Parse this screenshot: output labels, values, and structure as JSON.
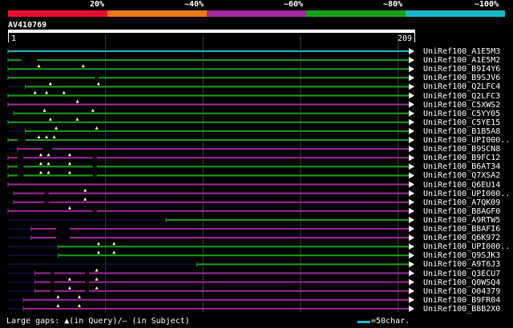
{
  "legend": {
    "labels": [
      "20%",
      "~40%",
      "~60%",
      "~80%",
      "~100%"
    ],
    "colors": [
      "#e8102e",
      "#e87818",
      "#a0289e",
      "#18a018",
      "#18b8c8"
    ]
  },
  "query": {
    "id": "AV410769",
    "start": "1",
    "end": "209",
    "length": 209
  },
  "hits": [
    {
      "name": "UniRef100_A1E5M3",
      "color": "#18b8c8",
      "start": 1,
      "end": 209,
      "gaps": []
    },
    {
      "name": "UniRef100_A1E5M2",
      "color": "#18a018",
      "start": 1,
      "end": 209,
      "gaps": [
        [
          8,
          16
        ]
      ],
      "ins": []
    },
    {
      "name": "UniRef100_B9I4Y6",
      "color": "#18a018",
      "start": 1,
      "end": 209,
      "gaps": [],
      "ins": [
        17,
        40
      ]
    },
    {
      "name": "UniRef100_B9SJV6",
      "color": "#18a018",
      "start": 1,
      "end": 209,
      "gaps": [
        [
          46,
          48
        ]
      ],
      "ins": []
    },
    {
      "name": "UniRef100_Q2LFC4",
      "color": "#18a018",
      "start": 10,
      "end": 209,
      "gaps": [],
      "ins": [
        23,
        48
      ]
    },
    {
      "name": "UniRef100_Q2LFC3",
      "color": "#18a018",
      "start": 1,
      "end": 209,
      "gaps": [],
      "ins": [
        15,
        21,
        30
      ]
    },
    {
      "name": "UniRef100_C5XWS2",
      "color": "#a0289e",
      "start": 1,
      "end": 209,
      "gaps": [],
      "ins": [
        37
      ]
    },
    {
      "name": "UniRef100_C5YY05",
      "color": "#18a018",
      "start": 4,
      "end": 209,
      "gaps": [],
      "ins": [
        20,
        45
      ]
    },
    {
      "name": "UniRef100_C5YE15",
      "color": "#18a018",
      "start": 1,
      "end": 209,
      "gaps": [],
      "ins": [
        23,
        37
      ]
    },
    {
      "name": "UniRef100_B1B5A8",
      "color": "#18a018",
      "start": 10,
      "end": 209,
      "gaps": [],
      "ins": [
        26,
        47
      ]
    },
    {
      "name": "UniRef100_UPI000..",
      "color": "#18a018",
      "start": 1,
      "end": 209,
      "gaps": [
        [
          6,
          10
        ]
      ],
      "ins": [
        17,
        21,
        25
      ]
    },
    {
      "name": "UniRef100_B9SCN8",
      "color": "#a0289e",
      "start": 6,
      "end": 209,
      "gaps": [
        [
          19,
          24
        ]
      ],
      "ins": []
    },
    {
      "name": "UniRef100_B9FC12",
      "color": "#a0289e",
      "start": 1,
      "end": 209,
      "gaps": [
        [
          6,
          9
        ],
        [
          45,
          47
        ]
      ],
      "ins": [
        18,
        22,
        33
      ]
    },
    {
      "name": "UniRef100_B6AT34",
      "color": "#18a018",
      "start": 1,
      "end": 209,
      "gaps": [
        [
          6,
          9
        ],
        [
          45,
          47
        ]
      ],
      "ins": [
        18,
        22,
        33
      ]
    },
    {
      "name": "UniRef100_Q7XSA2",
      "color": "#18a018",
      "start": 1,
      "end": 209,
      "gaps": [
        [
          6,
          9
        ],
        [
          45,
          47
        ]
      ],
      "ins": [
        18,
        22,
        33
      ]
    },
    {
      "name": "UniRef100_Q6EU14",
      "color": "#a0289e",
      "start": 1,
      "end": 209,
      "gaps": [],
      "ins": []
    },
    {
      "name": "UniRef100_UPI000..",
      "color": "#a0289e",
      "start": 4,
      "end": 209,
      "gaps": [
        [
          20,
          22
        ]
      ],
      "ins": [
        41
      ]
    },
    {
      "name": "UniRef100_A7QK09",
      "color": "#a0289e",
      "start": 4,
      "end": 209,
      "gaps": [
        [
          20,
          22
        ]
      ],
      "ins": [
        41
      ]
    },
    {
      "name": "UniRef100_B8AGF0",
      "color": "#a0289e",
      "start": 1,
      "end": 209,
      "gaps": [
        [
          45,
          47
        ]
      ],
      "ins": [
        33
      ]
    },
    {
      "name": "UniRef100_A9RTW5",
      "color": "#18a018",
      "start": 83,
      "end": 209,
      "gaps": [],
      "ins": []
    },
    {
      "name": "UniRef100_B8AFI6",
      "color": "#a0289e",
      "start": 13,
      "end": 209,
      "gaps": [
        [
          26,
          33
        ]
      ],
      "ins": []
    },
    {
      "name": "UniRef100_Q6K972",
      "color": "#a0289e",
      "start": 13,
      "end": 209,
      "gaps": [
        [
          26,
          33
        ]
      ],
      "ins": []
    },
    {
      "name": "UniRef100_UPI000..",
      "color": "#18a018",
      "start": 27,
      "end": 209,
      "gaps": [],
      "ins": [
        48,
        56
      ]
    },
    {
      "name": "UniRef100_Q9SJK3",
      "color": "#18a018",
      "start": 27,
      "end": 209,
      "gaps": [],
      "ins": [
        48,
        56
      ]
    },
    {
      "name": "UniRef100_A9T6J3",
      "color": "#18a018",
      "start": 99,
      "end": 209,
      "gaps": [],
      "ins": []
    },
    {
      "name": "UniRef100_Q3ECU7",
      "color": "#a0289e",
      "start": 15,
      "end": 209,
      "gaps": [
        [
          23,
          25
        ],
        [
          41,
          43
        ]
      ],
      "ins": [
        47
      ]
    },
    {
      "name": "UniRef100_Q0WSQ4",
      "color": "#a0289e",
      "start": 15,
      "end": 209,
      "gaps": [
        [
          23,
          25
        ],
        [
          41,
          43
        ]
      ],
      "ins": [
        33,
        47
      ]
    },
    {
      "name": "UniRef100_O04379",
      "color": "#a0289e",
      "start": 15,
      "end": 209,
      "gaps": [
        [
          23,
          25
        ],
        [
          41,
          43
        ]
      ],
      "ins": [
        33,
        47
      ]
    },
    {
      "name": "UniRef100_B9FR04",
      "color": "#a0289e",
      "start": 9,
      "end": 209,
      "gaps": [],
      "ins": [
        27,
        38
      ]
    },
    {
      "name": "UniRef100_B8B2X0",
      "color": "#a0289e",
      "start": 9,
      "end": 209,
      "gaps": [],
      "ins": [
        27,
        38
      ]
    }
  ],
  "footer": {
    "gaps_text": "Large gaps: ▲(in Query)/— (in Subject)",
    "scale_text": "=50char.",
    "scale_color": "#18b8c8"
  }
}
